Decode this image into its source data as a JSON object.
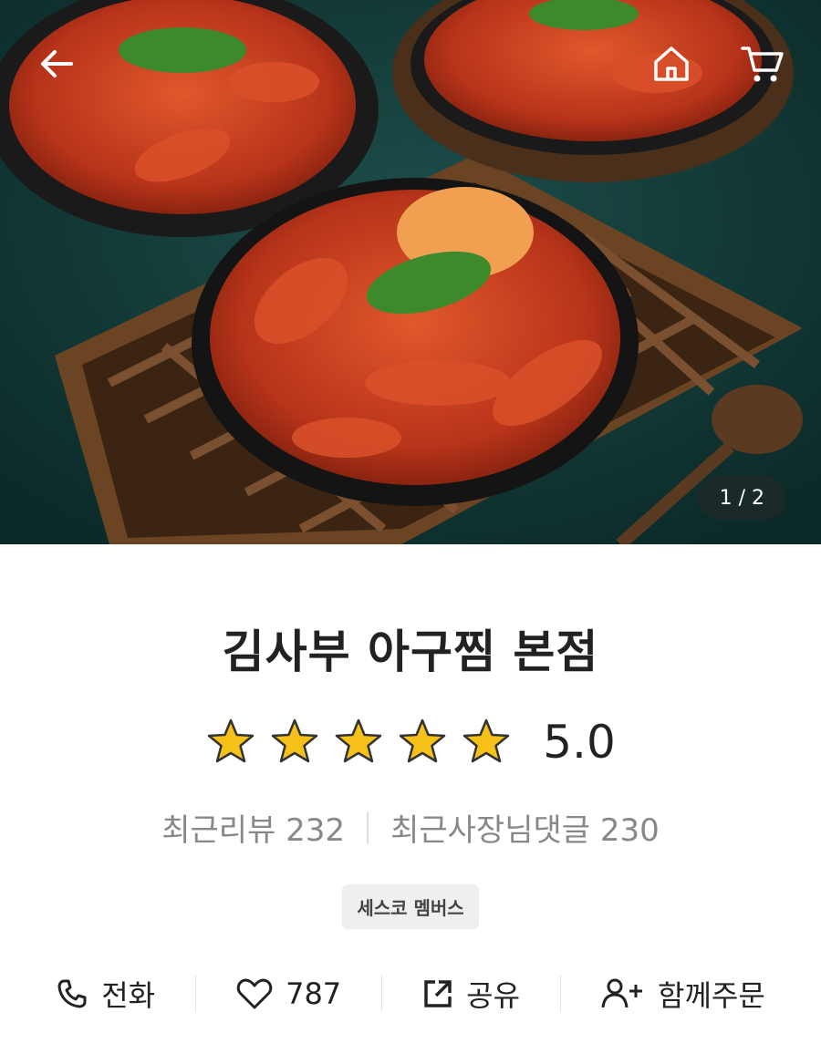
{
  "hero": {
    "counter": "1 / 2"
  },
  "store": {
    "name": "김사부 아구찜 본점",
    "rating": "5.0",
    "stars_filled": 5
  },
  "counts": {
    "reviews": "최근리뷰 232",
    "owner_replies": "최근사장님댓글 230"
  },
  "badge": "세스코 멤버스",
  "actions": {
    "call": "전화",
    "likes": "787",
    "share": "공유",
    "group_order": "함께주문"
  }
}
